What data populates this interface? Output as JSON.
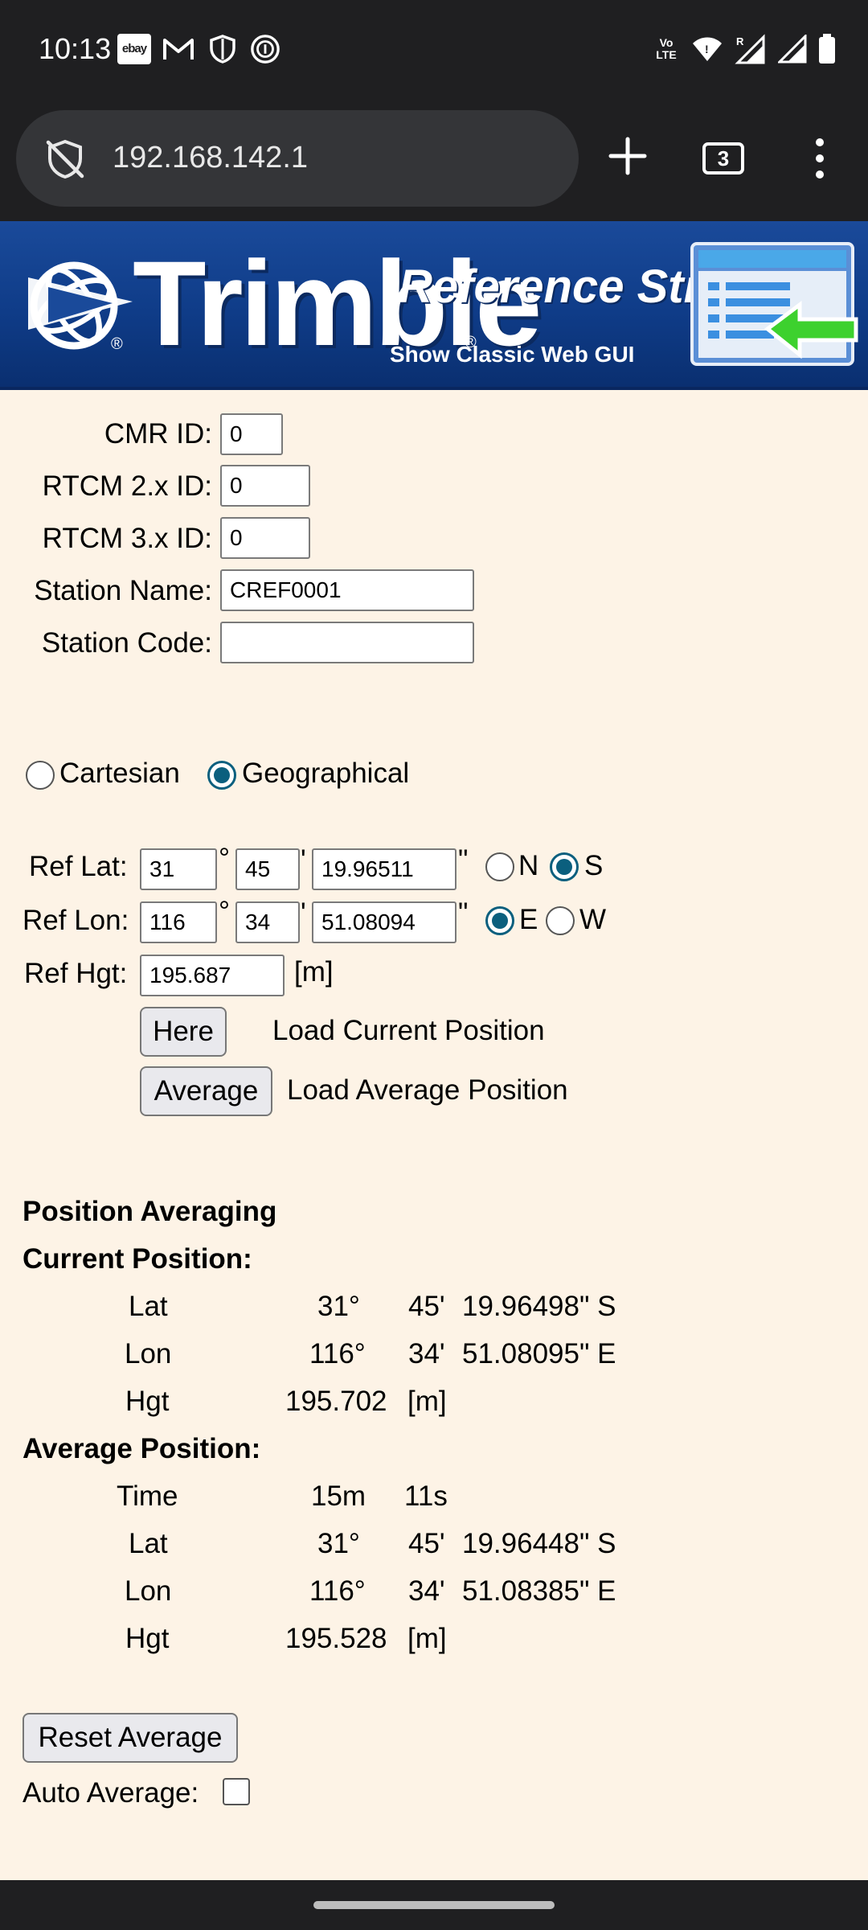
{
  "status_bar": {
    "time": "10:13",
    "notif_ebay": "ebay",
    "volte": "Vo LTE",
    "signal_roaming": "R"
  },
  "browser": {
    "url": "192.168.142.1",
    "tab_count": "3"
  },
  "banner": {
    "brand": "Trimble",
    "reg_mark": "®",
    "title": "Reference Stn",
    "classic_link": "Show Classic Web GUI"
  },
  "ids": {
    "cmr_label": "CMR ID:",
    "cmr_value": "0",
    "rtcm2_label": "RTCM 2.x ID:",
    "rtcm2_value": "0",
    "rtcm3_label": "RTCM 3.x ID:",
    "rtcm3_value": "0",
    "station_name_label": "Station Name:",
    "station_name_value": "CREF0001",
    "station_code_label": "Station Code:",
    "station_code_value": ""
  },
  "coord_system": {
    "cartesian": "Cartesian",
    "geographical": "Geographical",
    "selected": "Geographical"
  },
  "ref": {
    "lat_label": "Ref Lat:",
    "lat_deg": "31",
    "lat_min": "45",
    "lat_sec": "19.96511",
    "lat_n": "N",
    "lat_s": "S",
    "lat_hemisphere": "S",
    "lon_label": "Ref Lon:",
    "lon_deg": "116",
    "lon_min": "34",
    "lon_sec": "51.08094",
    "lon_e": "E",
    "lon_w": "W",
    "lon_hemisphere": "E",
    "deg_sym": "°",
    "min_sym": "'",
    "sec_sym": "\"",
    "hgt_label": "Ref Hgt:",
    "hgt_value": "195.687",
    "hgt_unit": "[m]",
    "here_button": "Here",
    "here_desc": "Load Current Position",
    "average_button": "Average",
    "average_desc": "Load Average Position"
  },
  "averaging": {
    "section_title": "Position Averaging",
    "current_title": "Current Position:",
    "current": [
      {
        "label": "Lat",
        "deg": "31°",
        "min": "45'",
        "sec": "19.96498\" S"
      },
      {
        "label": "Lon",
        "deg": "116°",
        "min": "34'",
        "sec": "51.08095\" E"
      }
    ],
    "current_hgt": {
      "label": "Hgt",
      "value": "195.702",
      "unit": "[m]"
    },
    "average_title": "Average Position:",
    "time": {
      "label": "Time",
      "min": "15m",
      "sec": "11s"
    },
    "average": [
      {
        "label": "Lat",
        "deg": "31°",
        "min": "45'",
        "sec": "19.96448\" S"
      },
      {
        "label": "Lon",
        "deg": "116°",
        "min": "34'",
        "sec": "51.08385\" E"
      }
    ],
    "average_hgt": {
      "label": "Hgt",
      "value": "195.528",
      "unit": "[m]"
    },
    "reset_button": "Reset Average",
    "auto_average_label": "Auto Average:",
    "auto_average_checked": false
  }
}
